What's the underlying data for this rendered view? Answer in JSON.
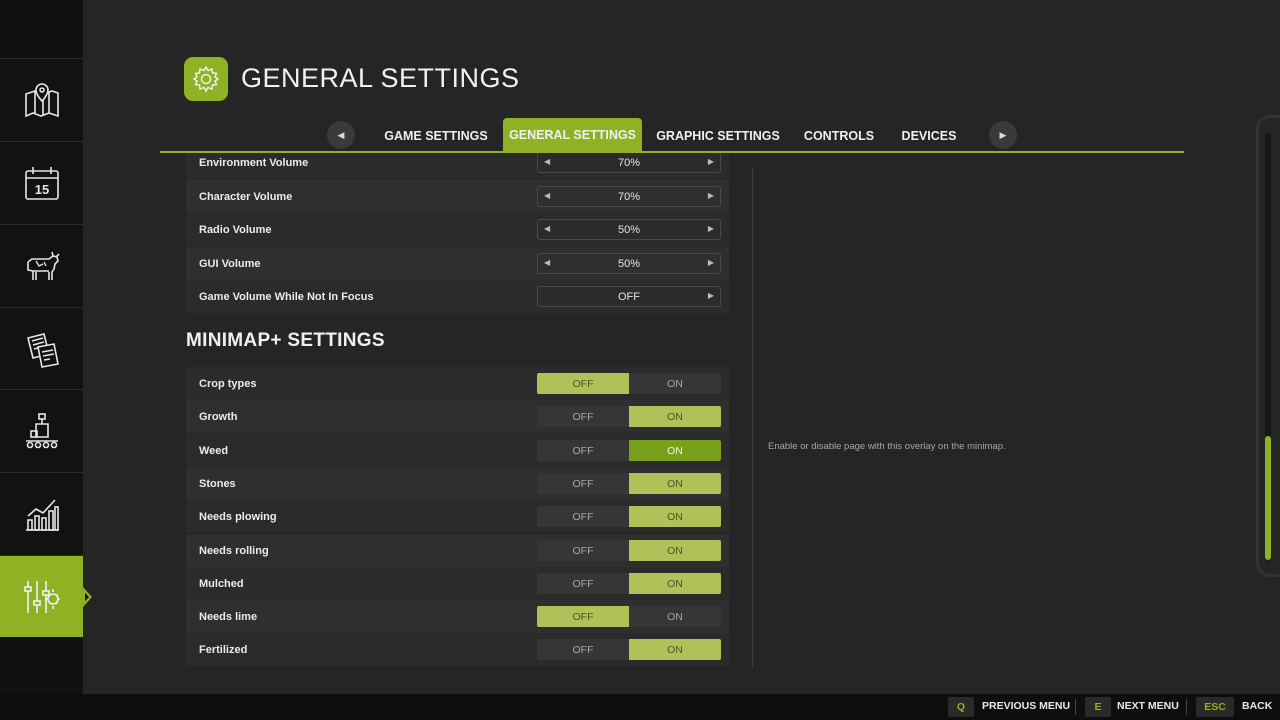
{
  "header": {
    "title": "GENERAL SETTINGS",
    "icon": "gear-icon"
  },
  "tabs": [
    {
      "label": "GAME SETTINGS",
      "active": false
    },
    {
      "label": "GENERAL SETTINGS",
      "active": true
    },
    {
      "label": "GRAPHIC SETTINGS",
      "active": false
    },
    {
      "label": "CONTROLS",
      "active": false
    },
    {
      "label": "DEVICES",
      "active": false
    }
  ],
  "tab_nav": {
    "prev": "◀",
    "next": "▶"
  },
  "sidebar": {
    "items": [
      {
        "icon": "map-pin-icon"
      },
      {
        "icon": "calendar-icon",
        "text": "15"
      },
      {
        "icon": "cow-icon"
      },
      {
        "icon": "contracts-icon"
      },
      {
        "icon": "production-icon"
      },
      {
        "icon": "statistics-icon"
      },
      {
        "icon": "settings-sliders-icon",
        "active": true
      }
    ]
  },
  "audio_rows": [
    {
      "label": "Environment Volume",
      "value": "70%",
      "arrows": true
    },
    {
      "label": "Character Volume",
      "value": "70%",
      "arrows": true
    },
    {
      "label": "Radio Volume",
      "value": "50%",
      "arrows": true
    },
    {
      "label": "GUI Volume",
      "value": "50%",
      "arrows": true
    },
    {
      "label": "Game Volume While Not In Focus",
      "value": "OFF",
      "arrows": false
    }
  ],
  "selector_arrows": {
    "left": "◀",
    "right": "▶"
  },
  "minimap": {
    "title": "MINIMAP+ SETTINGS",
    "off_label": "OFF",
    "on_label": "ON",
    "rows": [
      {
        "label": "Crop types",
        "value": "OFF",
        "focused": false
      },
      {
        "label": "Growth",
        "value": "ON",
        "focused": false
      },
      {
        "label": "Weed",
        "value": "ON",
        "focused": true
      },
      {
        "label": "Stones",
        "value": "ON",
        "focused": false
      },
      {
        "label": "Needs plowing",
        "value": "ON",
        "focused": false
      },
      {
        "label": "Needs rolling",
        "value": "ON",
        "focused": false
      },
      {
        "label": "Mulched",
        "value": "ON",
        "focused": false
      },
      {
        "label": "Needs lime",
        "value": "OFF",
        "focused": false
      },
      {
        "label": "Fertilized",
        "value": "ON",
        "focused": false
      }
    ]
  },
  "description": "Enable or disable page with this overlay on the minimap.",
  "footer": [
    {
      "key": "Q",
      "label": "PREVIOUS MENU"
    },
    {
      "key": "E",
      "label": "NEXT MENU"
    },
    {
      "key": "ESC",
      "label": "BACK"
    }
  ],
  "colors": {
    "accent": "#8fb225",
    "selected_soft": "#aec259",
    "selected_strong": "#79a01c"
  }
}
